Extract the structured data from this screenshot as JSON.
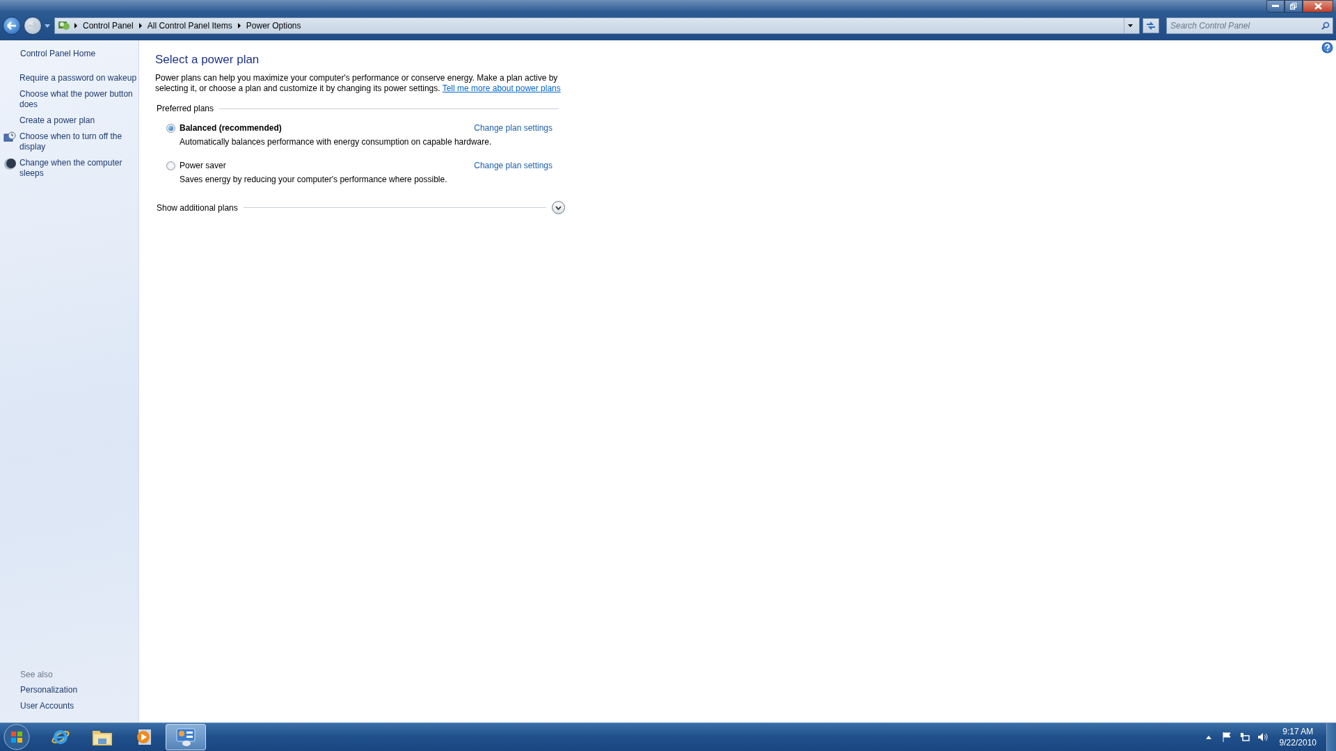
{
  "nav": {
    "back_enabled": true,
    "forward_enabled": false,
    "breadcrumbs": [
      "Control Panel",
      "All Control Panel Items",
      "Power Options"
    ],
    "search": {
      "placeholder": "Search Control Panel"
    }
  },
  "sidebar": {
    "home": "Control Panel Home",
    "tasks": [
      {
        "label": "Require a password on wakeup",
        "kind": "plain"
      },
      {
        "label": "Choose what the power button does",
        "kind": "plain"
      },
      {
        "label": "Create a power plan",
        "kind": "plain"
      },
      {
        "label": "Choose when to turn off the display",
        "kind": "display"
      },
      {
        "label": "Change when the computer sleeps",
        "kind": "sleep"
      }
    ],
    "see_also": {
      "heading": "See also",
      "links": [
        "Personalization",
        "User Accounts"
      ]
    }
  },
  "main": {
    "title": "Select a power plan",
    "intro": "Power plans can help you maximize your computer's performance or conserve energy. Make a plan active by selecting it, or choose a plan and customize it by changing its power settings.",
    "intro_link": "Tell me more about power plans",
    "group": "Preferred plans",
    "plans": [
      {
        "name": "Balanced (recommended)",
        "description": "Automatically balances performance with energy consumption on capable hardware.",
        "action": "Change plan settings",
        "selected": true
      },
      {
        "name": "Power saver",
        "description": "Saves energy by reducing your computer's performance where possible.",
        "action": "Change plan settings",
        "selected": false
      }
    ],
    "more": {
      "label": "Show additional plans",
      "expanded": false
    }
  },
  "taskbar": {
    "buttons": [
      {
        "kind": "browser",
        "selected": false
      },
      {
        "kind": "folder",
        "selected": false
      },
      {
        "kind": "media",
        "selected": false
      },
      {
        "kind": "control-panel",
        "selected": true
      }
    ],
    "clock": {
      "time": "9:17 AM",
      "date": "9/22/2010"
    }
  }
}
